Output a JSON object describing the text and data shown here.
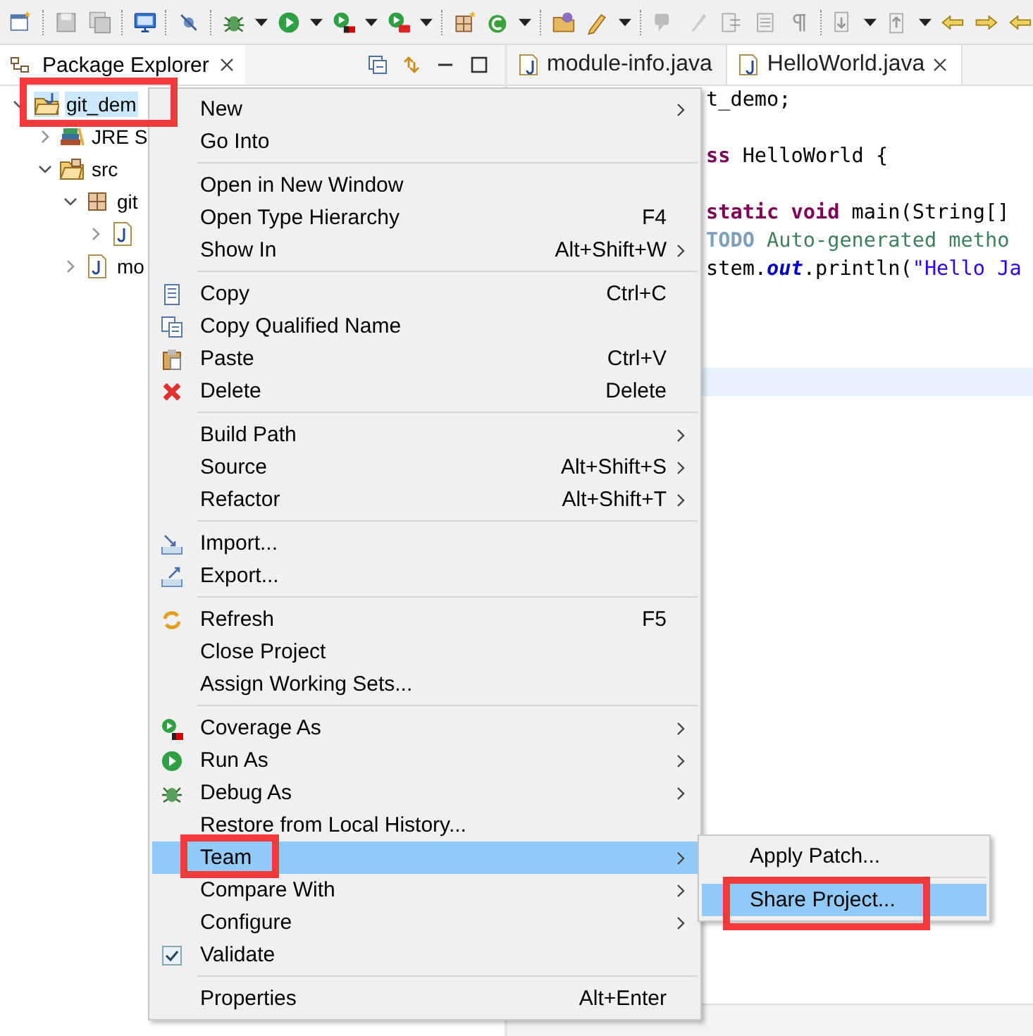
{
  "explorer": {
    "title": "Package Explorer",
    "tree": [
      {
        "kind": "project",
        "label": "git_dem",
        "expanded": true,
        "selected": true,
        "highlighted": true,
        "children": [
          {
            "kind": "library",
            "label": "JRE S",
            "expanded": false,
            "selected": false
          },
          {
            "kind": "folder",
            "label": "src",
            "expanded": true,
            "selected": false,
            "children": [
              {
                "kind": "package",
                "label": "git",
                "expanded": true,
                "selected": false,
                "children": [
                  {
                    "kind": "javafile",
                    "expanded": false,
                    "selected": false
                  }
                ]
              },
              {
                "kind": "javafile",
                "label": "mo",
                "expanded": false,
                "selected": false
              }
            ]
          }
        ]
      }
    ]
  },
  "editor": {
    "tabs": [
      {
        "label": "module-info.java",
        "selected": false
      },
      {
        "label": "HelloWorld.java",
        "selected": true
      }
    ],
    "lines": [
      {
        "current": false,
        "segments": [
          {
            "kind": "plain",
            "text": "t_demo;"
          }
        ]
      },
      {
        "current": false
      },
      {
        "current": false,
        "segments": [
          {
            "kind": "keyword",
            "text": "ss"
          },
          {
            "kind": "plain",
            "text": " HelloWorld {"
          }
        ]
      },
      {
        "current": false
      },
      {
        "current": false,
        "segments": [
          {
            "kind": "keyword",
            "text": "static void"
          },
          {
            "kind": "plain",
            "text": " main(String[]"
          }
        ]
      },
      {
        "current": false,
        "segments": [
          {
            "kind": "task",
            "text": "TODO"
          },
          {
            "kind": "comment",
            "text": " Auto-generated metho"
          }
        ]
      },
      {
        "current": false,
        "segments": [
          {
            "kind": "plain",
            "text": "stem."
          },
          {
            "kind": "field",
            "text": "out"
          },
          {
            "kind": "plain",
            "text": ".println("
          },
          {
            "kind": "string",
            "text": "\"Hello Ja"
          }
        ]
      },
      {
        "current": false
      },
      {
        "current": false
      },
      {
        "current": false
      },
      {
        "current": true
      }
    ]
  },
  "menu": {
    "groups": [
      [
        {
          "label": "New",
          "submenu": true,
          "selected": false
        },
        {
          "label": "Go Into",
          "submenu": false,
          "selected": false
        }
      ],
      [
        {
          "label": "Open in New Window",
          "submenu": false,
          "selected": false
        },
        {
          "label": "Open Type Hierarchy",
          "shortcut": "F4",
          "submenu": false,
          "selected": false
        },
        {
          "label": "Show In",
          "shortcut": "Alt+Shift+W",
          "submenu": true,
          "selected": false
        }
      ],
      [
        {
          "label": "Copy",
          "shortcut": "Ctrl+C",
          "submenu": false,
          "selected": false
        },
        {
          "label": "Copy Qualified Name",
          "submenu": false,
          "selected": false
        },
        {
          "label": "Paste",
          "shortcut": "Ctrl+V",
          "submenu": false,
          "selected": false
        },
        {
          "label": "Delete",
          "shortcut": "Delete",
          "submenu": false,
          "selected": false
        }
      ],
      [
        {
          "label": "Build Path",
          "submenu": true,
          "selected": false
        },
        {
          "label": "Source",
          "shortcut": "Alt+Shift+S",
          "submenu": true,
          "selected": false
        },
        {
          "label": "Refactor",
          "shortcut": "Alt+Shift+T",
          "submenu": true,
          "selected": false
        }
      ],
      [
        {
          "label": "Import...",
          "submenu": false,
          "selected": false
        },
        {
          "label": "Export...",
          "submenu": false,
          "selected": false
        }
      ],
      [
        {
          "label": "Refresh",
          "shortcut": "F5",
          "submenu": false,
          "selected": false
        },
        {
          "label": "Close Project",
          "submenu": false,
          "selected": false
        },
        {
          "label": "Assign Working Sets...",
          "submenu": false,
          "selected": false
        }
      ],
      [
        {
          "label": "Coverage As",
          "submenu": true,
          "selected": false
        },
        {
          "label": "Run As",
          "submenu": true,
          "selected": false
        },
        {
          "label": "Debug As",
          "submenu": true,
          "selected": false
        },
        {
          "label": "Restore from Local History...",
          "submenu": false,
          "selected": false
        },
        {
          "label": "Team",
          "submenu": true,
          "selected": true,
          "highlighted": true
        },
        {
          "label": "Compare With",
          "submenu": true,
          "selected": false
        },
        {
          "label": "Configure",
          "submenu": true,
          "selected": false
        },
        {
          "label": "Validate",
          "kind": "check",
          "checked": true,
          "submenu": false,
          "selected": false
        }
      ],
      [
        {
          "label": "Properties",
          "shortcut": "Alt+Enter",
          "submenu": false,
          "selected": false
        }
      ]
    ]
  },
  "submenu": {
    "groups": [
      [
        {
          "label": "Apply Patch...",
          "selected": false
        }
      ],
      [
        {
          "label": "Share Project...",
          "selected": true,
          "highlighted": true
        }
      ]
    ]
  }
}
